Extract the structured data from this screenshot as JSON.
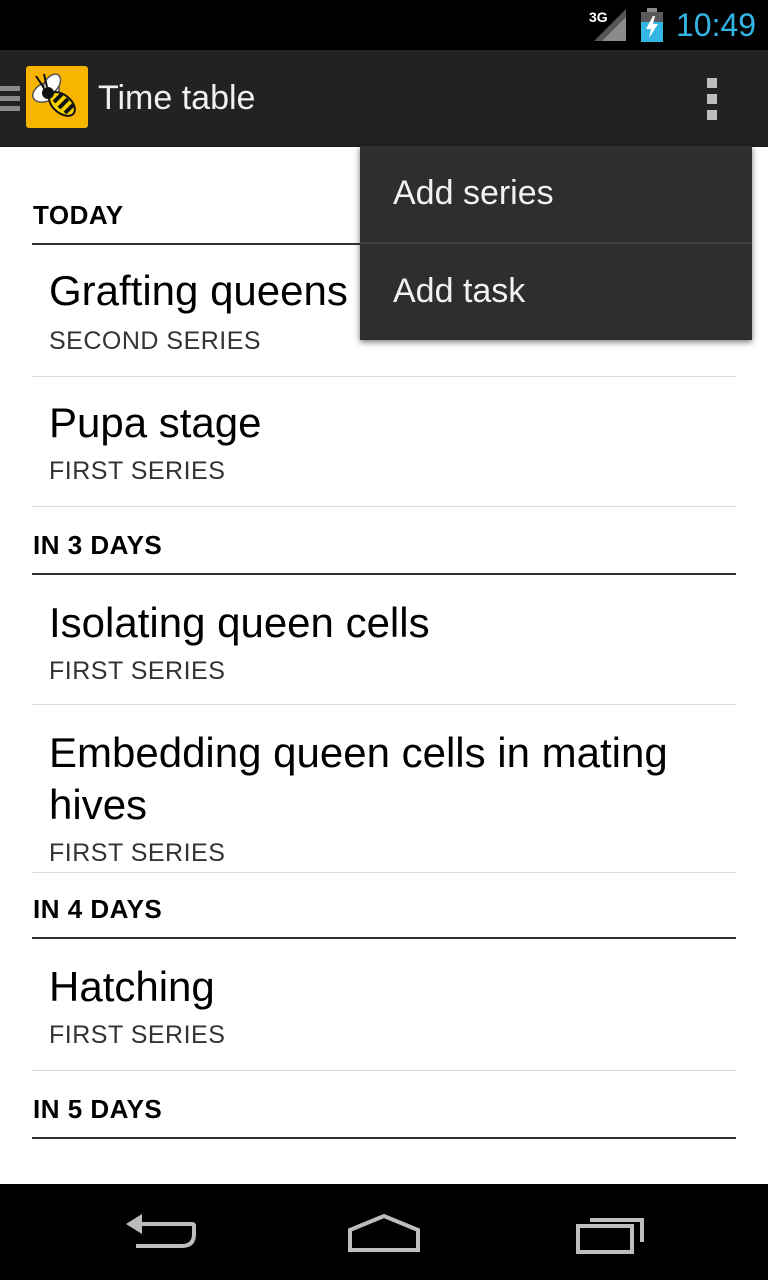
{
  "status_bar": {
    "network_label": "3G",
    "time": "10:49",
    "clock_color": "#33b5e5",
    "icons": [
      "signal-icon",
      "battery-charging-icon"
    ]
  },
  "action_bar": {
    "title": "Time table",
    "icons": [
      "drawer-icon",
      "bee-logo-icon",
      "overflow-menu-icon"
    ],
    "logo_color": "#f7b500"
  },
  "menu": {
    "items": [
      {
        "label": "Add series"
      },
      {
        "label": "Add task"
      }
    ]
  },
  "sections": [
    {
      "header": "TODAY",
      "items": [
        {
          "title": "Grafting queens",
          "subtitle": "SECOND SERIES"
        },
        {
          "title": "Pupa stage",
          "subtitle": "FIRST SERIES"
        }
      ]
    },
    {
      "header": "IN 3 DAYS",
      "items": [
        {
          "title": "Isolating queen cells",
          "subtitle": "FIRST SERIES"
        },
        {
          "title": "Embedding queen cells in mating hives",
          "subtitle": "FIRST SERIES"
        }
      ]
    },
    {
      "header": "IN 4 DAYS",
      "items": [
        {
          "title": "Hatching",
          "subtitle": "FIRST SERIES"
        }
      ]
    },
    {
      "header": "IN 5 DAYS",
      "items": []
    }
  ],
  "nav_bar": {
    "icons": [
      "back-icon",
      "home-icon",
      "recent-apps-icon"
    ]
  }
}
